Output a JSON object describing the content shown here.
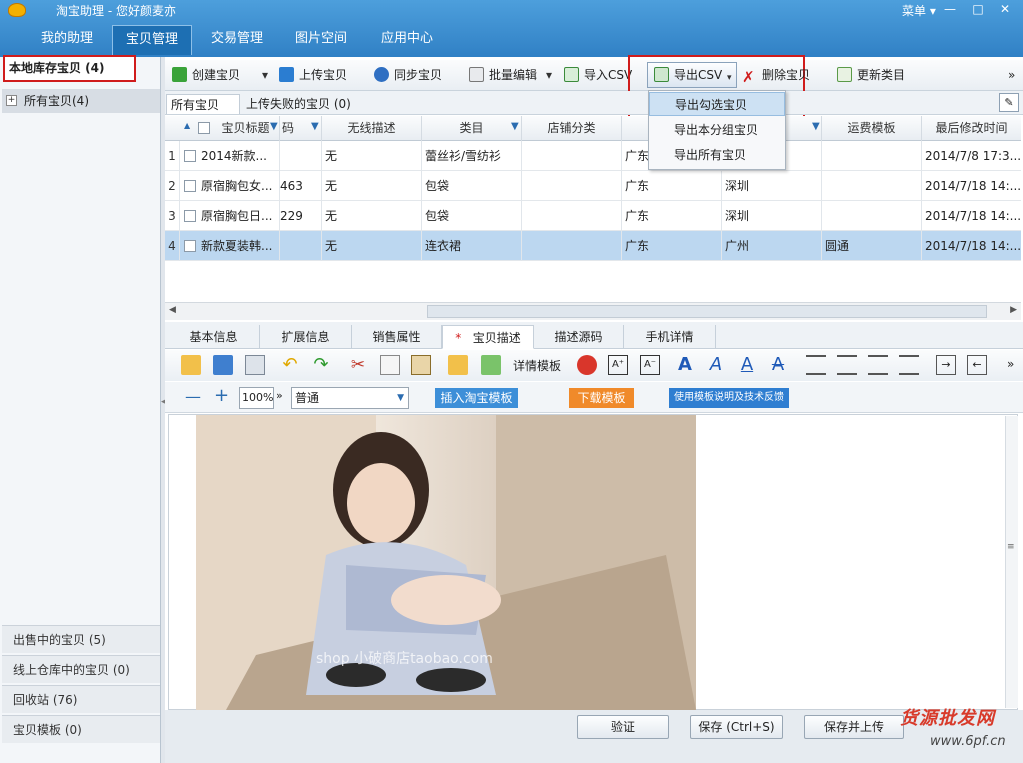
{
  "app": {
    "title": "淘宝助理 - 您好颜麦亦",
    "menu_label": "菜单 ▾",
    "window_buttons": {
      "min": "—",
      "max": "□",
      "close": "✕"
    }
  },
  "nav": {
    "tabs": [
      "我的助理",
      "宝贝管理",
      "交易管理",
      "图片空间",
      "应用中心"
    ],
    "active": 1
  },
  "sidebar": {
    "title": "本地库存宝贝 (4)",
    "tree_item": "所有宝贝(4)",
    "bottom_items": [
      "出售中的宝贝 (5)",
      "线上仓库中的宝贝 (0)",
      "回收站 (76)",
      "宝贝模板 (0)"
    ]
  },
  "toolbar": {
    "create": "创建宝贝",
    "upload": "上传宝贝",
    "sync": "同步宝贝",
    "batch_edit": "批量编辑",
    "import_csv": "导入CSV",
    "export_csv": "导出CSV",
    "delete": "删除宝贝",
    "update_category": "更新类目",
    "more": "»"
  },
  "export_menu": {
    "items": [
      "导出勾选宝贝",
      "导出本分组宝贝",
      "导出所有宝贝"
    ]
  },
  "subtabs": [
    "所有宝贝 (4)",
    "上传失败的宝贝 (0)"
  ],
  "grid": {
    "headers": [
      "宝贝标题",
      "码",
      "无线描述",
      "类目",
      "店铺分类",
      "所在地",
      "",
      "运费模板",
      "最后修改时间"
    ],
    "rows": [
      {
        "num": "1",
        "title": "2014新款...",
        "code": "",
        "wireless": "无",
        "category": "蕾丝衫/雪纺衫",
        "shop_cat": "",
        "province": "广东",
        "city": "",
        "freight": "",
        "modified": "2014/7/8 17:3..."
      },
      {
        "num": "2",
        "title": "原宿胸包女...",
        "code": "463",
        "wireless": "无",
        "category": "包袋",
        "shop_cat": "",
        "province": "广东",
        "city": "深圳",
        "freight": "",
        "modified": "2014/7/18 14:..."
      },
      {
        "num": "3",
        "title": "原宿胸包日...",
        "code": "229",
        "wireless": "无",
        "category": "包袋",
        "shop_cat": "",
        "province": "广东",
        "city": "深圳",
        "freight": "",
        "modified": "2014/7/18 14:..."
      },
      {
        "num": "4",
        "title": "新款夏装韩...",
        "code": "",
        "wireless": "无",
        "category": "连衣裙",
        "shop_cat": "",
        "province": "广东",
        "city": "广州",
        "freight": "圆通",
        "modified": "2014/7/18 14:..."
      }
    ],
    "selected_row": 4
  },
  "editor": {
    "tabs": [
      "基本信息",
      "扩展信息",
      "销售属性",
      "宝贝描述",
      "描述源码",
      "手机详情"
    ],
    "active_tab": 3,
    "required_mark": "*",
    "detail_template_label": "详情模板",
    "zoom": "100%",
    "format": "普通",
    "insert_template": "插入淘宝模板",
    "download_template": "下载模板",
    "template_help": "使用模板说明及技术反馈"
  },
  "photo": {
    "watermark_text": "shop 小破商店taobao.com"
  },
  "bottom": {
    "verify": "验证",
    "save": "保存 (Ctrl+S)",
    "save_upload": "保存并上传"
  },
  "site_watermark": {
    "line1": "货源批发网",
    "line2": "www.6pf.cn"
  },
  "colors": {
    "titlebar": "#3a8ccf",
    "selected_row": "#bcd7f0",
    "highlight_red": "#d01c1c"
  }
}
